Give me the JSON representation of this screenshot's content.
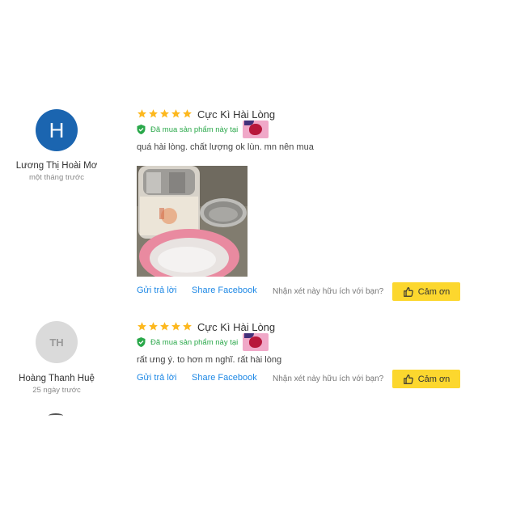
{
  "reviews": [
    {
      "avatar_letter": "H",
      "name": "Lương Thị Hoài Mơ",
      "time": "một tháng trước",
      "rating": 5,
      "title": "Cực Kì Hài Lòng",
      "verified": "Đã mua sản phẩm này tại",
      "comment": "quá hài lòng. chất lượng ok lùn. mn nên mua",
      "has_photo": true,
      "reply": "Gửi trả lời",
      "share": "Share Facebook",
      "helpful_question": "Nhận xét này hữu ích với bạn?",
      "thanks": "Cảm ơn"
    },
    {
      "avatar_letter": "TH",
      "name": "Hoàng Thanh Huệ",
      "time": "25 ngày trước",
      "rating": 5,
      "title": "Cực Kì Hài Lòng",
      "verified": "Đã mua sản phẩm này tại",
      "comment": "rất ưng ý. to hơn m nghĩ. rất hài lòng",
      "has_photo": false,
      "reply": "Gửi trả lời",
      "share": "Share Facebook",
      "helpful_question": "Nhận xét này hữu ích với bạn?",
      "thanks": "Cảm ơn"
    }
  ],
  "colors": {
    "star": "#fdb81e",
    "verified": "#2aa84a",
    "link": "#1e88e5",
    "thanks_bg": "#fcd72e",
    "avatar_blue": "#1b65b0"
  }
}
